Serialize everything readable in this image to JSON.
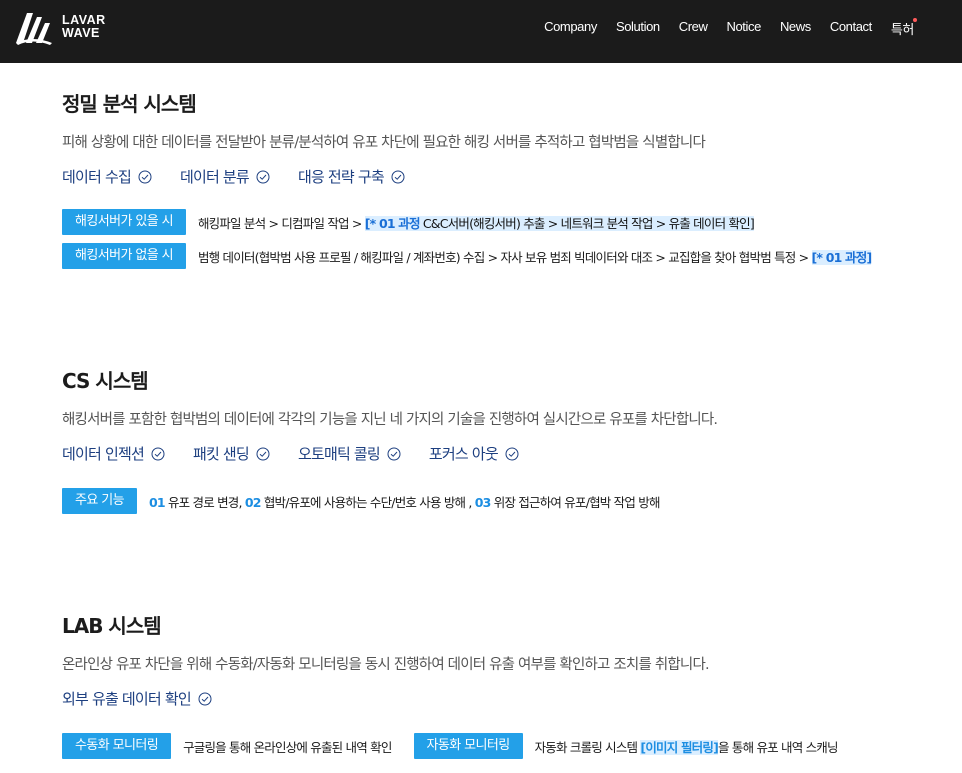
{
  "brand": {
    "line1": "LAVAR",
    "line2": "WAVE",
    "logo_icon": "lavar-wave-logo-icon"
  },
  "nav": [
    "Company",
    "Solution",
    "Crew",
    "Notice",
    "News",
    "Contact",
    "특허"
  ],
  "colors": {
    "header_bg": "#1b1b1b",
    "accent": "#23a0e8",
    "feature_text": "#1d3f80",
    "highlight_bg": "#dbeeff"
  },
  "sections": [
    {
      "title": "정밀 분석 시스템",
      "desc": "피해 상황에 대한 데이터를 전달받아 분류/분석하여 유포 차단에 필요한 해킹 서버를 추적하고 협박범을 식별합니다",
      "features": [
        "데이터 수집",
        "데이터 분류",
        "대응 전략 구축"
      ],
      "rows": [
        {
          "tag": "해킹서버가 있을 시",
          "plain": "해킹파일 분석 > 디컴파일 작업 > ",
          "hl_lead": "[* 01 과정",
          "hl_rest": " C&C서버(해킹서버) 추출 > 네트워크 분석 작업 > 유출 데이터 확인]"
        },
        {
          "tag": "해킹서버가 없을 시",
          "plain": "범행 데이터(협박범 사용 프로필 / 해킹파일 / 계좌번호) 수집 > 자사 보유 범죄 빅데이터와 대조 > 교집합을 찾아 협박범 특정 > ",
          "hl_lead": "[* 01 과정]"
        }
      ]
    },
    {
      "title": "CS 시스템",
      "desc": "해킹서버를 포함한 협박범의 데이터에 각각의 기능을 지닌 네 가지의 기술을 진행하여 실시간으로 유포를 차단합니다.",
      "features": [
        "데이터 인젝션",
        "패킷 샌딩",
        "오토매틱 콜링",
        "포커스 아웃"
      ],
      "row": {
        "tag": "주요 기능",
        "items": [
          {
            "num": "01",
            "text": " 유포 경로 변경, "
          },
          {
            "num": "02",
            "text": " 협박/유포에 사용하는 수단/번호 사용 방해 , "
          },
          {
            "num": "03",
            "text": " 위장 접근하여 유포/협박 작업 방해"
          }
        ]
      }
    },
    {
      "title": "LAB 시스템",
      "desc": "온라인상 유포 차단을 위해 수동화/자동화 모니터링을 동시 진행하여 데이터 유출 여부를 확인하고 조치를 취합니다.",
      "features": [
        "외부 유출 데이터 확인"
      ],
      "rows": [
        {
          "tag": "수동화 모니터링",
          "text": "구글링을 통해 온라인상에 유출된 내역 확인"
        },
        {
          "tag": "자동화 모니터링",
          "pre": "자동화 크롤링 시스템 ",
          "blue": "[이미지 필터링]",
          "post": "을 통해 유포 내역 스캐닝"
        }
      ]
    }
  ]
}
